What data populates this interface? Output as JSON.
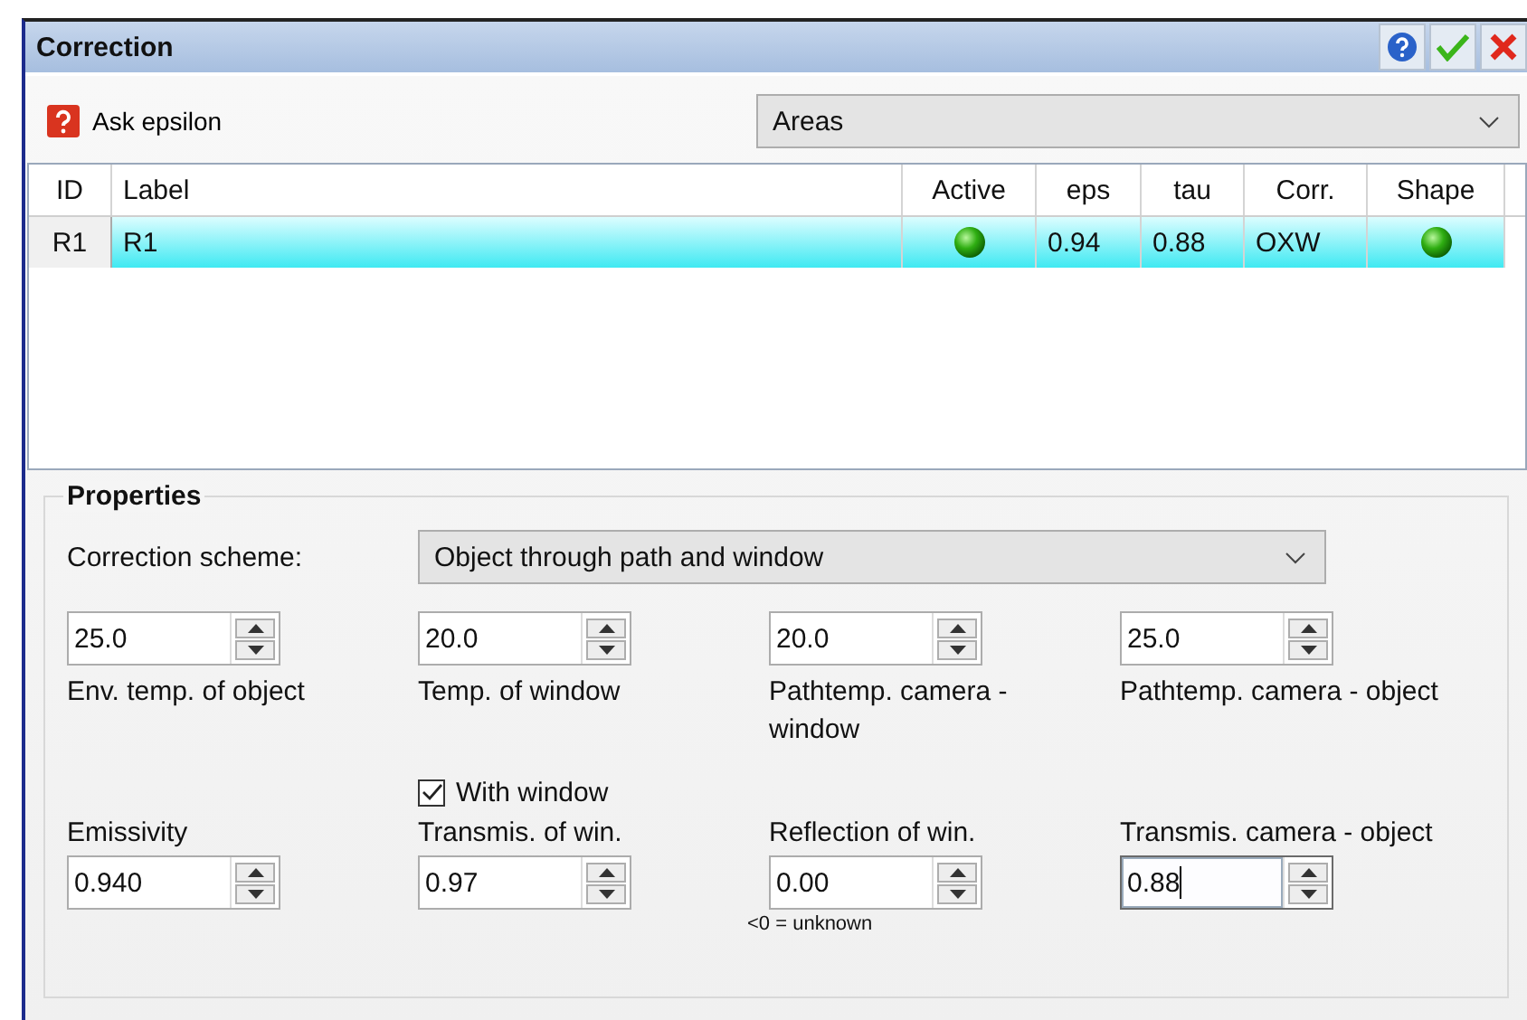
{
  "window": {
    "title": "Correction"
  },
  "toolbar": {
    "ask_button": "Ask epsilon",
    "selector": "Areas"
  },
  "table": {
    "columns": [
      "ID",
      "Label",
      "Active",
      "eps",
      "tau",
      "Corr.",
      "Shape"
    ],
    "rows": [
      {
        "id": "R1",
        "label": "R1",
        "active": true,
        "eps": "0.94",
        "tau": "0.88",
        "corr": "OXW",
        "shape": true,
        "selected": true
      }
    ]
  },
  "properties": {
    "title": "Properties",
    "scheme_label": "Correction scheme:",
    "scheme_value": "Object through path and window",
    "top_fields": [
      {
        "value": "25.0",
        "label": "Env. temp. of object",
        "focused": false
      },
      {
        "value": "20.0",
        "label": "Temp. of window",
        "focused": false
      },
      {
        "value": "20.0",
        "label": "Pathtemp. camera - window",
        "focused": false
      },
      {
        "value": "25.0",
        "label": "Pathtemp. camera - object",
        "focused": false
      }
    ],
    "with_window": {
      "label": "With window",
      "checked": true
    },
    "bottom_fields": [
      {
        "value": "0.940",
        "label": "Emissivity",
        "focused": false
      },
      {
        "value": "0.97",
        "label": "Transmis. of win.",
        "focused": false
      },
      {
        "value": "0.00",
        "label": "Reflection of win.",
        "note": "<0 = unknown",
        "focused": false
      },
      {
        "value": "0.88",
        "label": "Transmis. camera - object",
        "focused": true
      }
    ]
  }
}
